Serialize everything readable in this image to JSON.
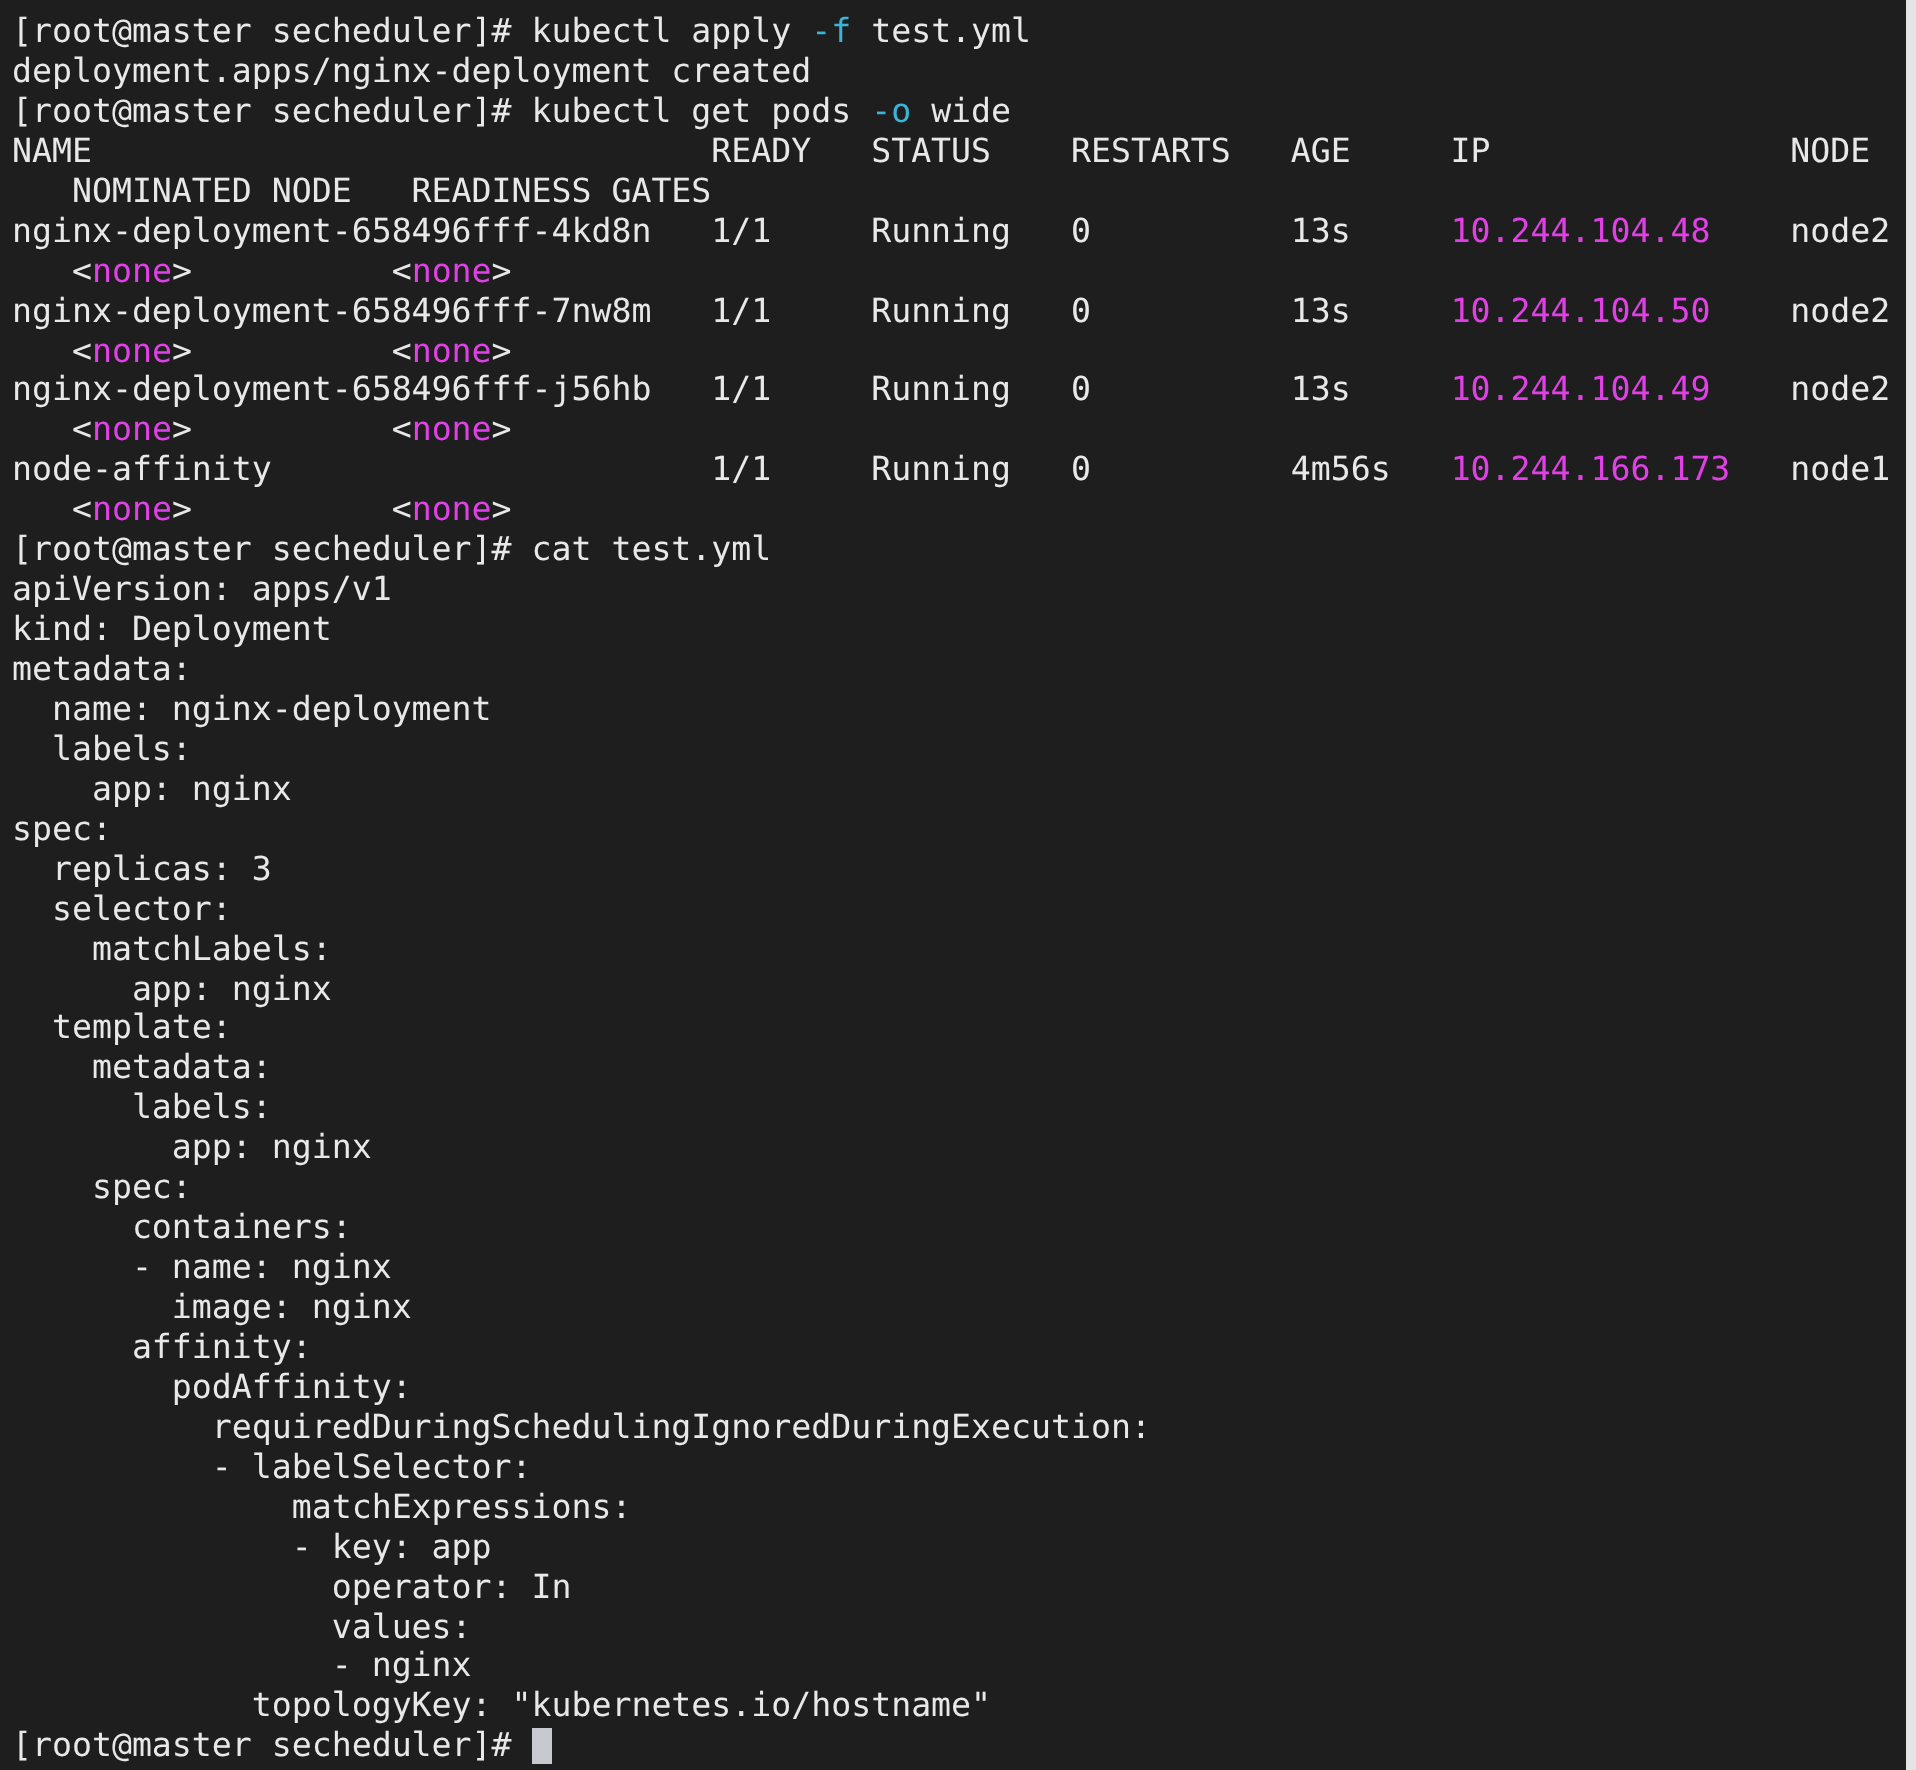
{
  "terminal": {
    "lines": [
      {
        "segments": [
          {
            "text": "[root@master secheduler]# kubectl apply ",
            "kind": "plain"
          },
          {
            "text": "-f",
            "kind": "option"
          },
          {
            "text": " test.yml",
            "kind": "plain"
          }
        ]
      },
      {
        "segments": [
          {
            "text": "deployment.apps/nginx-deployment created",
            "kind": "plain"
          }
        ]
      },
      {
        "segments": [
          {
            "text": "[root@master secheduler]# kubectl get pods ",
            "kind": "plain"
          },
          {
            "text": "-o",
            "kind": "option"
          },
          {
            "text": " wide",
            "kind": "plain"
          }
        ]
      },
      {
        "segments": [
          {
            "text": "NAME                               READY   STATUS    RESTARTS   AGE     IP               NODE",
            "kind": "plain"
          }
        ]
      },
      {
        "segments": [
          {
            "text": "   NOMINATED NODE   READINESS GATES",
            "kind": "plain"
          }
        ]
      },
      {
        "segments": [
          {
            "text": "nginx-deployment-658496fff-4kd8n   1/1     Running   0          13s     ",
            "kind": "plain"
          },
          {
            "text": "10.244.104.48",
            "kind": "value"
          },
          {
            "text": "    node2",
            "kind": "plain"
          }
        ]
      },
      {
        "segments": [
          {
            "text": "   <",
            "kind": "plain"
          },
          {
            "text": "none",
            "kind": "value"
          },
          {
            "text": ">          <",
            "kind": "plain"
          },
          {
            "text": "none",
            "kind": "value"
          },
          {
            "text": ">",
            "kind": "plain"
          }
        ]
      },
      {
        "segments": [
          {
            "text": "nginx-deployment-658496fff-7nw8m   1/1     Running   0          13s     ",
            "kind": "plain"
          },
          {
            "text": "10.244.104.50",
            "kind": "value"
          },
          {
            "text": "    node2",
            "kind": "plain"
          }
        ]
      },
      {
        "segments": [
          {
            "text": "   <",
            "kind": "plain"
          },
          {
            "text": "none",
            "kind": "value"
          },
          {
            "text": ">          <",
            "kind": "plain"
          },
          {
            "text": "none",
            "kind": "value"
          },
          {
            "text": ">",
            "kind": "plain"
          }
        ]
      },
      {
        "segments": [
          {
            "text": "nginx-deployment-658496fff-j56hb   1/1     Running   0          13s     ",
            "kind": "plain"
          },
          {
            "text": "10.244.104.49",
            "kind": "value"
          },
          {
            "text": "    node2",
            "kind": "plain"
          }
        ]
      },
      {
        "segments": [
          {
            "text": "   <",
            "kind": "plain"
          },
          {
            "text": "none",
            "kind": "value"
          },
          {
            "text": ">          <",
            "kind": "plain"
          },
          {
            "text": "none",
            "kind": "value"
          },
          {
            "text": ">",
            "kind": "plain"
          }
        ]
      },
      {
        "segments": [
          {
            "text": "node-affinity                      1/1     Running   0          4m56s   ",
            "kind": "plain"
          },
          {
            "text": "10.244.166.173",
            "kind": "value"
          },
          {
            "text": "   node1",
            "kind": "plain"
          }
        ]
      },
      {
        "segments": [
          {
            "text": "   <",
            "kind": "plain"
          },
          {
            "text": "none",
            "kind": "value"
          },
          {
            "text": ">          <",
            "kind": "plain"
          },
          {
            "text": "none",
            "kind": "value"
          },
          {
            "text": ">",
            "kind": "plain"
          }
        ]
      },
      {
        "segments": [
          {
            "text": "[root@master secheduler]# cat test.yml",
            "kind": "plain"
          }
        ]
      },
      {
        "segments": [
          {
            "text": "apiVersion: apps/v1",
            "kind": "plain"
          }
        ]
      },
      {
        "segments": [
          {
            "text": "kind: Deployment",
            "kind": "plain"
          }
        ]
      },
      {
        "segments": [
          {
            "text": "metadata:",
            "kind": "plain"
          }
        ]
      },
      {
        "segments": [
          {
            "text": "  name: nginx-deployment",
            "kind": "plain"
          }
        ]
      },
      {
        "segments": [
          {
            "text": "  labels:",
            "kind": "plain"
          }
        ]
      },
      {
        "segments": [
          {
            "text": "    app: nginx",
            "kind": "plain"
          }
        ]
      },
      {
        "segments": [
          {
            "text": "spec:",
            "kind": "plain"
          }
        ]
      },
      {
        "segments": [
          {
            "text": "  replicas: 3",
            "kind": "plain"
          }
        ]
      },
      {
        "segments": [
          {
            "text": "  selector:",
            "kind": "plain"
          }
        ]
      },
      {
        "segments": [
          {
            "text": "    matchLabels:",
            "kind": "plain"
          }
        ]
      },
      {
        "segments": [
          {
            "text": "      app: nginx",
            "kind": "plain"
          }
        ]
      },
      {
        "segments": [
          {
            "text": "  template:",
            "kind": "plain"
          }
        ]
      },
      {
        "segments": [
          {
            "text": "    metadata:",
            "kind": "plain"
          }
        ]
      },
      {
        "segments": [
          {
            "text": "      labels:",
            "kind": "plain"
          }
        ]
      },
      {
        "segments": [
          {
            "text": "        app: nginx",
            "kind": "plain"
          }
        ]
      },
      {
        "segments": [
          {
            "text": "    spec:",
            "kind": "plain"
          }
        ]
      },
      {
        "segments": [
          {
            "text": "      containers:",
            "kind": "plain"
          }
        ]
      },
      {
        "segments": [
          {
            "text": "      - name: nginx",
            "kind": "plain"
          }
        ]
      },
      {
        "segments": [
          {
            "text": "        image: nginx",
            "kind": "plain"
          }
        ]
      },
      {
        "segments": [
          {
            "text": "      affinity:",
            "kind": "plain"
          }
        ]
      },
      {
        "segments": [
          {
            "text": "        podAffinity:",
            "kind": "plain"
          }
        ]
      },
      {
        "segments": [
          {
            "text": "          requiredDuringSchedulingIgnoredDuringExecution:",
            "kind": "plain"
          }
        ]
      },
      {
        "segments": [
          {
            "text": "          - labelSelector:",
            "kind": "plain"
          }
        ]
      },
      {
        "segments": [
          {
            "text": "              matchExpressions:",
            "kind": "plain"
          }
        ]
      },
      {
        "segments": [
          {
            "text": "              - key: app",
            "kind": "plain"
          }
        ]
      },
      {
        "segments": [
          {
            "text": "                operator: In",
            "kind": "plain"
          }
        ]
      },
      {
        "segments": [
          {
            "text": "                values:",
            "kind": "plain"
          }
        ]
      },
      {
        "segments": [
          {
            "text": "                - nginx",
            "kind": "plain"
          }
        ]
      },
      {
        "segments": [
          {
            "text": "            topologyKey: \"kubernetes.io/hostname\"",
            "kind": "plain"
          }
        ]
      },
      {
        "segments": [
          {
            "text": "[root@master secheduler]# ",
            "kind": "plain"
          }
        ]
      }
    ],
    "cursor": {
      "visible": true
    }
  }
}
